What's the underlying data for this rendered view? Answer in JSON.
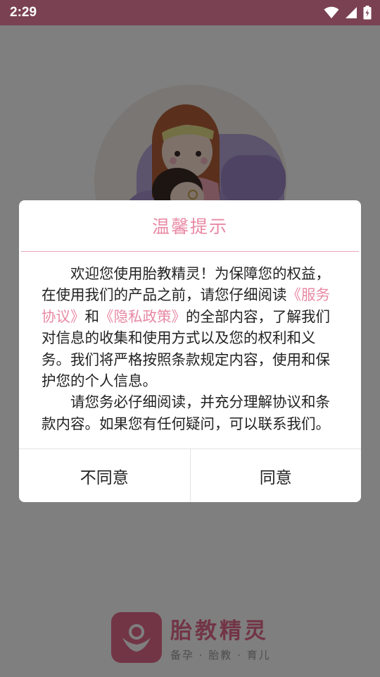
{
  "status_bar": {
    "time": "2:29",
    "icons": [
      "wifi-icon",
      "signal-icon",
      "battery-charging-icon"
    ]
  },
  "splash": {
    "illustration": "pregnant-mother-with-baby-illustration",
    "brand": {
      "name": "胎教精灵",
      "slogan": "备孕 · 胎教 · 育儿",
      "color": "#e56b8c"
    }
  },
  "dialog": {
    "title": "温馨提示",
    "paragraph1": {
      "text_before": "欢迎您使用胎教精灵！为保障您的权益，在使用我们的产品之前，请您仔细阅读",
      "link1": "《服务协议》",
      "text_middle": "和",
      "link2": "《隐私政策》",
      "text_after": "的全部内容，了解我们对信息的收集和使用方式以及您的权利和义务。我们将严格按照条款规定内容，使用和保护您的个人信息。"
    },
    "paragraph2": "请您务必仔细阅读，并充分理解协议和条款内容。如果您有任何疑问，可以联系我们。",
    "disagree_label": "不同意",
    "agree_label": "同意",
    "accent_color": "#e889a4"
  }
}
